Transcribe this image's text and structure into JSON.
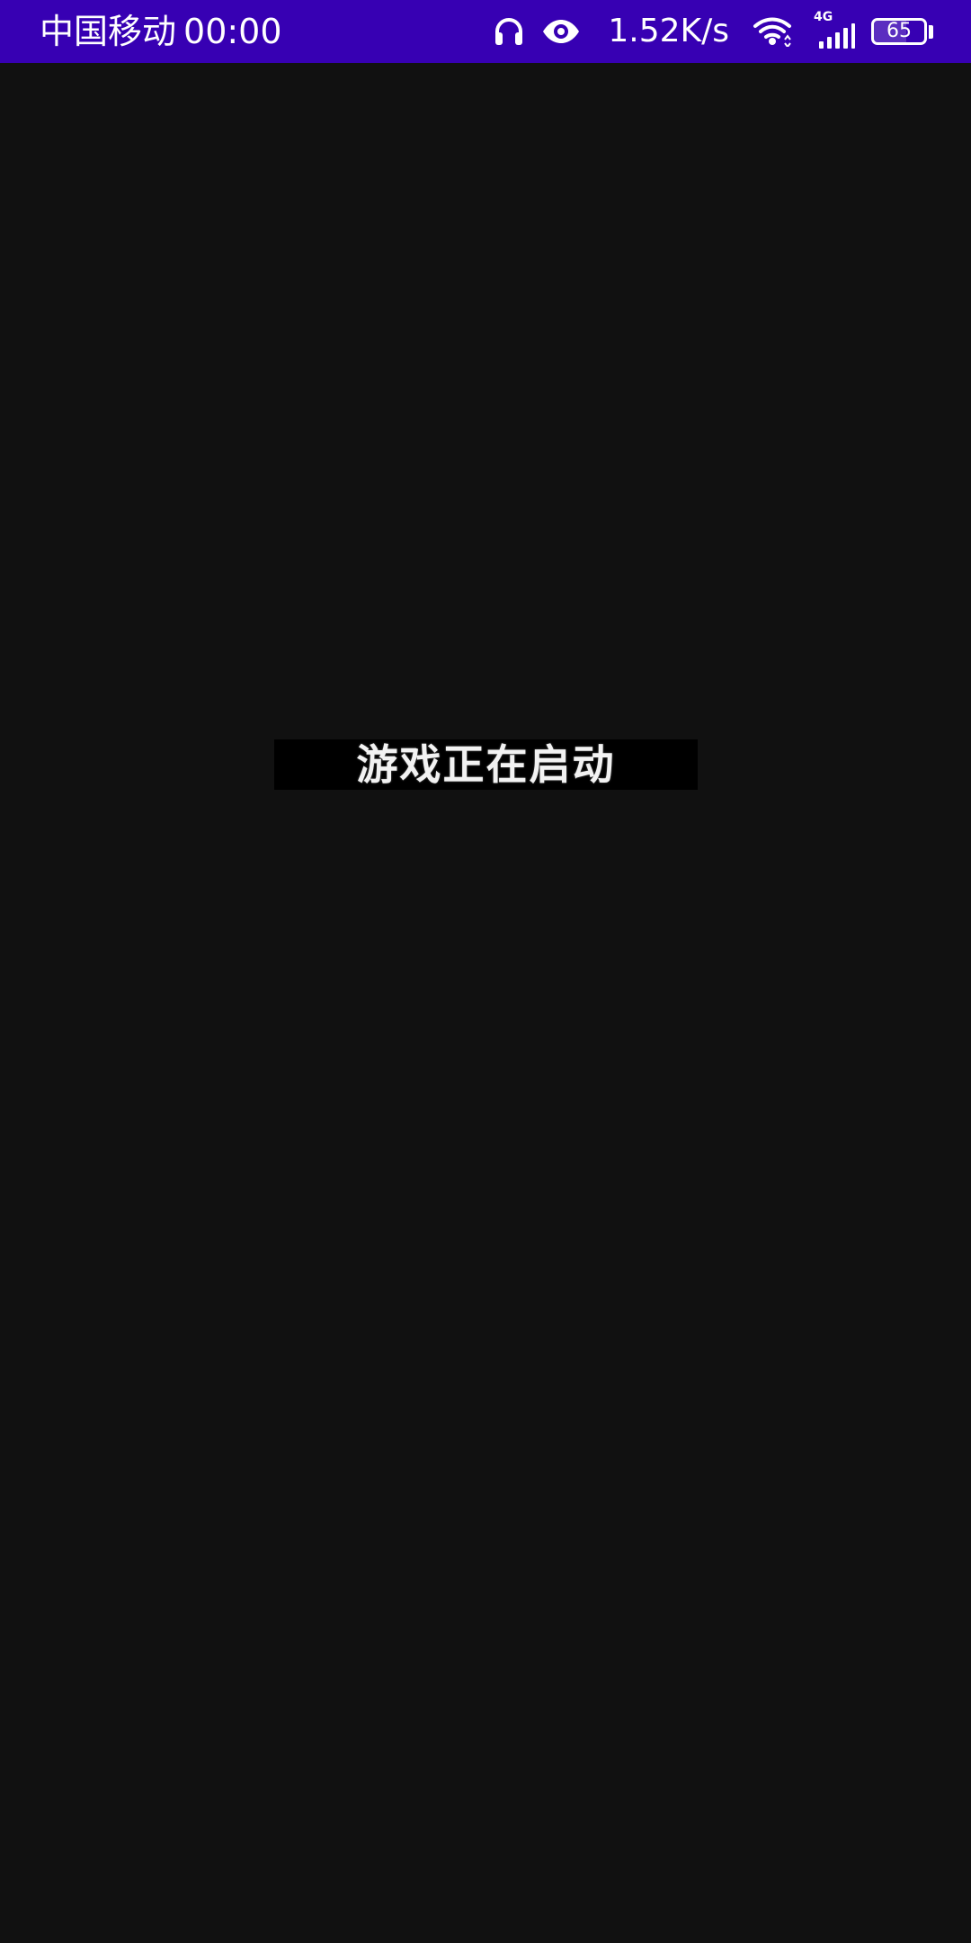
{
  "status_bar": {
    "carrier": "中国移动",
    "time": "00:00",
    "network_speed": "1.52K/s",
    "network_type": "4G",
    "battery_level": "65",
    "battery_fraction": 0.65,
    "background_color": "#3700b3",
    "icons": [
      "headphones-icon",
      "eye-icon",
      "wifi-icon",
      "cellular-signal-icon",
      "battery-icon"
    ]
  },
  "screen": {
    "background_color": "#111111",
    "loading_message": "游戏正在启动"
  }
}
